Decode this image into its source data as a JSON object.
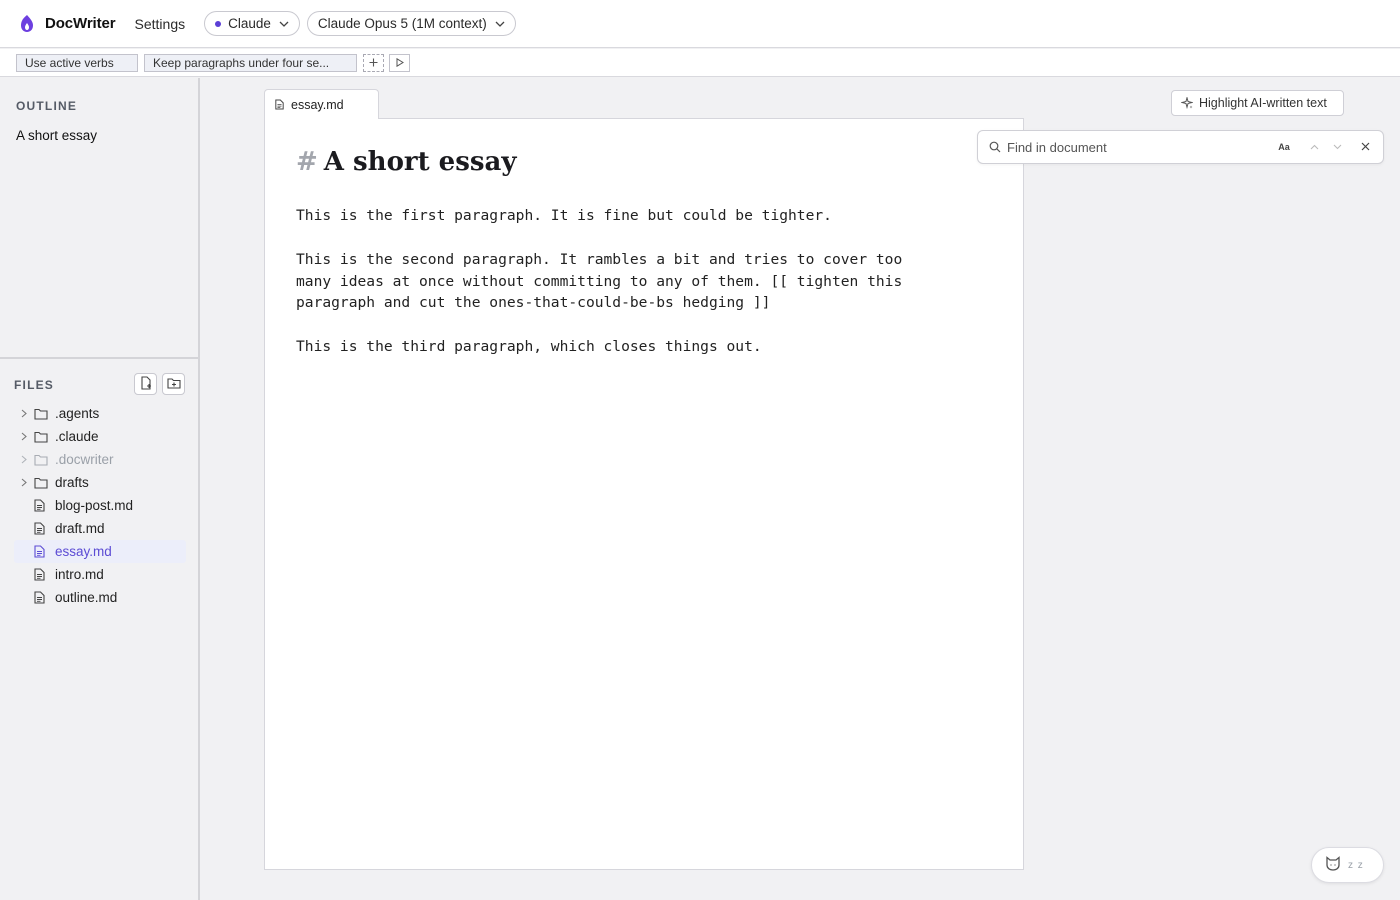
{
  "app": {
    "title": "DocWriter",
    "settings_label": "Settings",
    "accent_color": "#5b3fd6",
    "logo_icon": "flame-logo-icon"
  },
  "model_picker": {
    "provider": "Claude",
    "model": "Claude Opus 5 (1M context)"
  },
  "rules": {
    "items": [
      {
        "label": "Use active verbs"
      },
      {
        "label": "Keep paragraphs under four se..."
      }
    ],
    "add_icon": "plus-icon",
    "run_icon": "play-icon"
  },
  "sidebar": {
    "outline_heading": "OUTLINE",
    "outline_items": [
      {
        "label": "A short essay"
      }
    ],
    "files_heading": "FILES",
    "new_file_icon": "new-file-icon",
    "new_folder_icon": "new-folder-icon",
    "files": [
      {
        "name": ".agents",
        "type": "folder",
        "expandable": true
      },
      {
        "name": ".claude",
        "type": "folder",
        "expandable": true
      },
      {
        "name": ".docwriter",
        "type": "folder",
        "expandable": true,
        "muted": true
      },
      {
        "name": "drafts",
        "type": "folder",
        "expandable": true
      },
      {
        "name": "blog-post.md",
        "type": "file"
      },
      {
        "name": "draft.md",
        "type": "file"
      },
      {
        "name": "essay.md",
        "type": "file",
        "active": true
      },
      {
        "name": "intro.md",
        "type": "file"
      },
      {
        "name": "outline.md",
        "type": "file"
      }
    ]
  },
  "editor": {
    "tab_label": "essay.md",
    "heading_marker": "#",
    "heading": "A short essay",
    "paragraphs": [
      "This is the first paragraph. It is fine but could be tighter.",
      "This is the second paragraph. It rambles a bit and tries to cover too many ideas at once without committing to any of them. [[ tighten this paragraph and cut the ones-that-could-be-bs hedging ]]",
      "This is the third paragraph, which closes things out."
    ]
  },
  "highlight_button": {
    "label": "Highlight AI-written text",
    "icon": "sparkle-icon"
  },
  "find": {
    "placeholder": "Find in document",
    "value": "",
    "case_label": "Aa"
  },
  "status": {
    "icon": "cat-icon",
    "text": "z z"
  }
}
